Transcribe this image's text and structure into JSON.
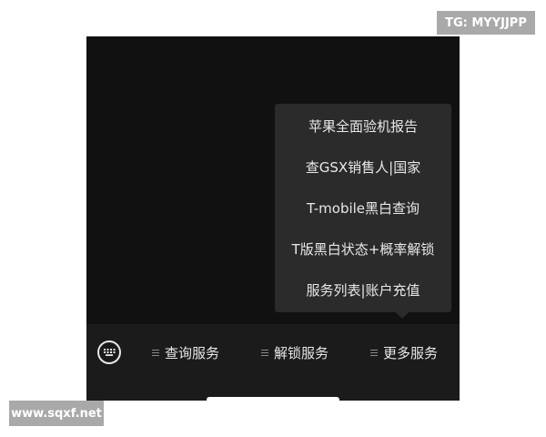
{
  "watermark_top": "TG: MYYJJPP",
  "watermark_bottom": "www.sqxf.net",
  "popup_menu": {
    "items": [
      "苹果全面验机报告",
      "查GSX销售人|国家",
      "T-mobile黑白查询",
      "T版黑白状态+概率解锁",
      "服务列表|账户充值"
    ]
  },
  "bottom_bar": {
    "keyboard_icon": "keyboard-icon",
    "tabs": [
      "查询服务",
      "解锁服务",
      "更多服务"
    ]
  },
  "colors": {
    "screen_bg": "#111111",
    "bar_bg": "#1b1b1b",
    "popup_bg": "#2b2b2b",
    "text": "#e8e8e8",
    "watermark_bg": "#a9a9a9"
  }
}
